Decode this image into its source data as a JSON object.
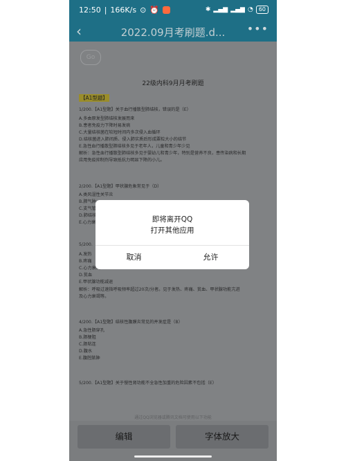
{
  "status_bar": {
    "time": "12:50",
    "speed": "166K/s",
    "battery": "60"
  },
  "title_bar": {
    "back_glyph": "‹",
    "title": "2022.09月考刷题.d...",
    "more_glyph": "•••"
  },
  "document": {
    "watermark": "Go",
    "title": "22级内科9月月考刷题",
    "section_label": "【A1型题】",
    "lines": [
      "1/200.【A1型题】关于血行播散型肺结核，错误的是（E）",
      "A.多由原发型肺结核发展而来",
      "B.患者免疫力下降时易发病",
      "C.大量结核菌在较短时间内多次侵入血循环",
      "D.结核菌进入肺间质、侵入肺实质后形成粟粒大小的结节",
      "E.急性血行播散型肺结核多见于老年人，儿童和青少年少见",
      "解析：急性血行播散型肺结核多见于婴幼儿和青少年，特别是营养不良，患传染病和长期",
      "应用免疫抑制剂导致抵抗力明显下降的小儿。",
      "2/200.【A1型题】甲状腺危象常见于（D）",
      "A.类风湿性关节炎",
      "B.肺气肿",
      "C.支气管",
      "D.肺结核",
      "E.心力衰",
      "5/200.",
      "A.发热",
      "B.疼痛",
      "C.心力衰竭",
      "D.贫血",
      "E.甲状腺功能减退",
      "解析：呼吸过速指呼吸频率超过20次/分者。见于发热、疼痛、贫血、甲状腺功能亢进",
      "及心力衰竭等。",
      "4/200.【A1型题】结核性腹膜炎常见的并发症是（B）",
      "A.急性肠穿孔",
      "B.肠梗阻",
      "C.肠粘连",
      "D.腹水",
      "E.腹腔脓肿",
      "5/200.【A1型题】关于慢性肾功能不全急性加重的危险因素不包括（E）"
    ],
    "bottom_hint": "通过QQ浏览器或腾讯文档可使用以下功能"
  },
  "bottom_bar": {
    "edit_label": "编辑",
    "font_label": "字体放大"
  },
  "dialog": {
    "line1": "即将离开QQ",
    "line2": "打开其他应用",
    "cancel_label": "取消",
    "allow_label": "允许"
  },
  "colors": {
    "status_bar_bg": "#1e6f86",
    "dialog_bg": "#ffffff",
    "dim_overlay": "#7b7d7f"
  },
  "icons": [
    "signal-icon",
    "wifi-icon",
    "battery-icon",
    "alarm-icon",
    "bluetooth-icon",
    "back-arrow-icon",
    "more-icon"
  ]
}
